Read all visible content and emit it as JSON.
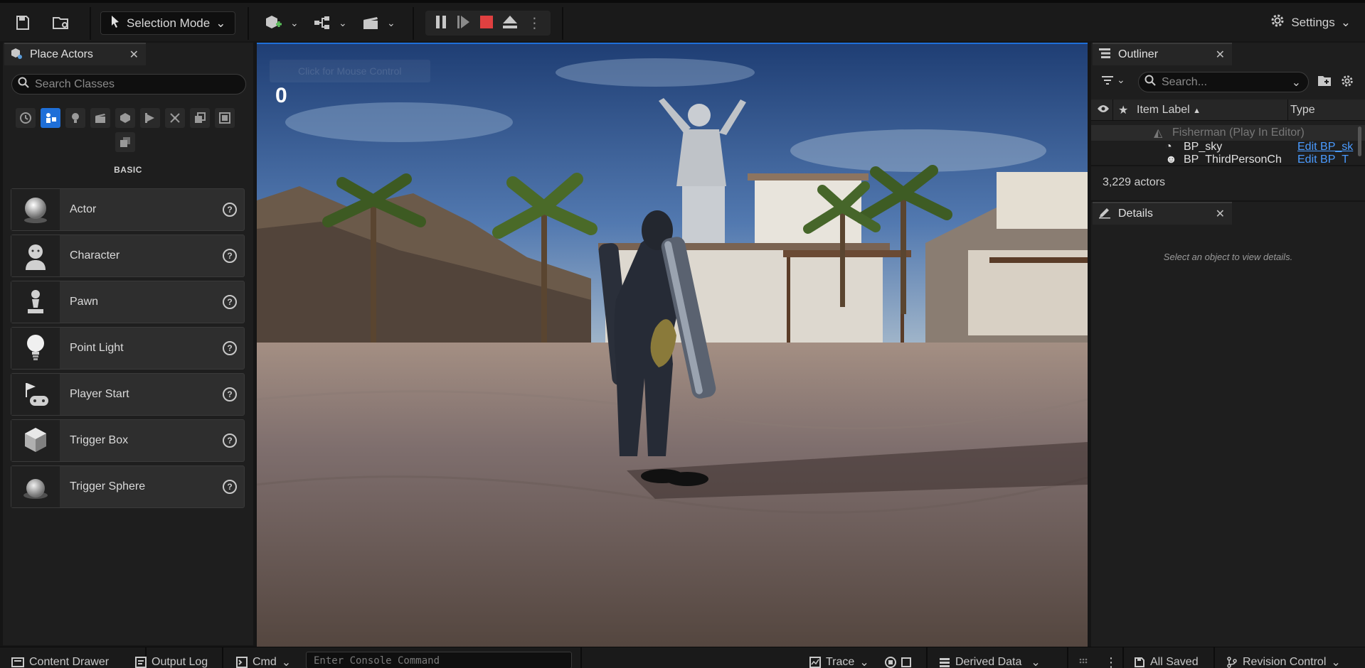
{
  "toolbar": {
    "selection_mode": "Selection Mode",
    "settings": "Settings"
  },
  "place_actors": {
    "tab_title": "Place Actors",
    "search_placeholder": "Search Classes",
    "category_label": "BASIC",
    "items": [
      {
        "label": "Actor",
        "icon": "sphere-icon"
      },
      {
        "label": "Character",
        "icon": "character-icon"
      },
      {
        "label": "Pawn",
        "icon": "pawn-icon"
      },
      {
        "label": "Point Light",
        "icon": "light-bulb-icon"
      },
      {
        "label": "Player Start",
        "icon": "player-start-icon"
      },
      {
        "label": "Trigger Box",
        "icon": "trigger-box-icon"
      },
      {
        "label": "Trigger Sphere",
        "icon": "trigger-sphere-icon"
      }
    ]
  },
  "viewport": {
    "hint": "Click for Mouse Control",
    "score": "0"
  },
  "outliner": {
    "tab_title": "Outliner",
    "search_placeholder": "Search...",
    "col_label": "Item Label",
    "col_type": "Type",
    "rows": [
      {
        "label": "Fisherman (Play In Editor)",
        "type": ""
      },
      {
        "label": "BP_sky",
        "type": "Edit BP_sk"
      },
      {
        "label": "BP_ThirdPersonCh",
        "type": "Edit BP_T"
      }
    ],
    "count": "3,229 actors"
  },
  "details": {
    "tab_title": "Details",
    "empty_message": "Select an object to view details."
  },
  "statusbar": {
    "content_drawer": "Content Drawer",
    "output_log": "Output Log",
    "cmd": "Cmd",
    "console_placeholder": "Enter Console Command",
    "trace": "Trace",
    "derived_data": "Derived Data",
    "all_saved": "All Saved",
    "revision_control": "Revision Control"
  },
  "colors": {
    "accent": "#1f6fd8",
    "stop": "#e04040",
    "link": "#4a9bff"
  }
}
